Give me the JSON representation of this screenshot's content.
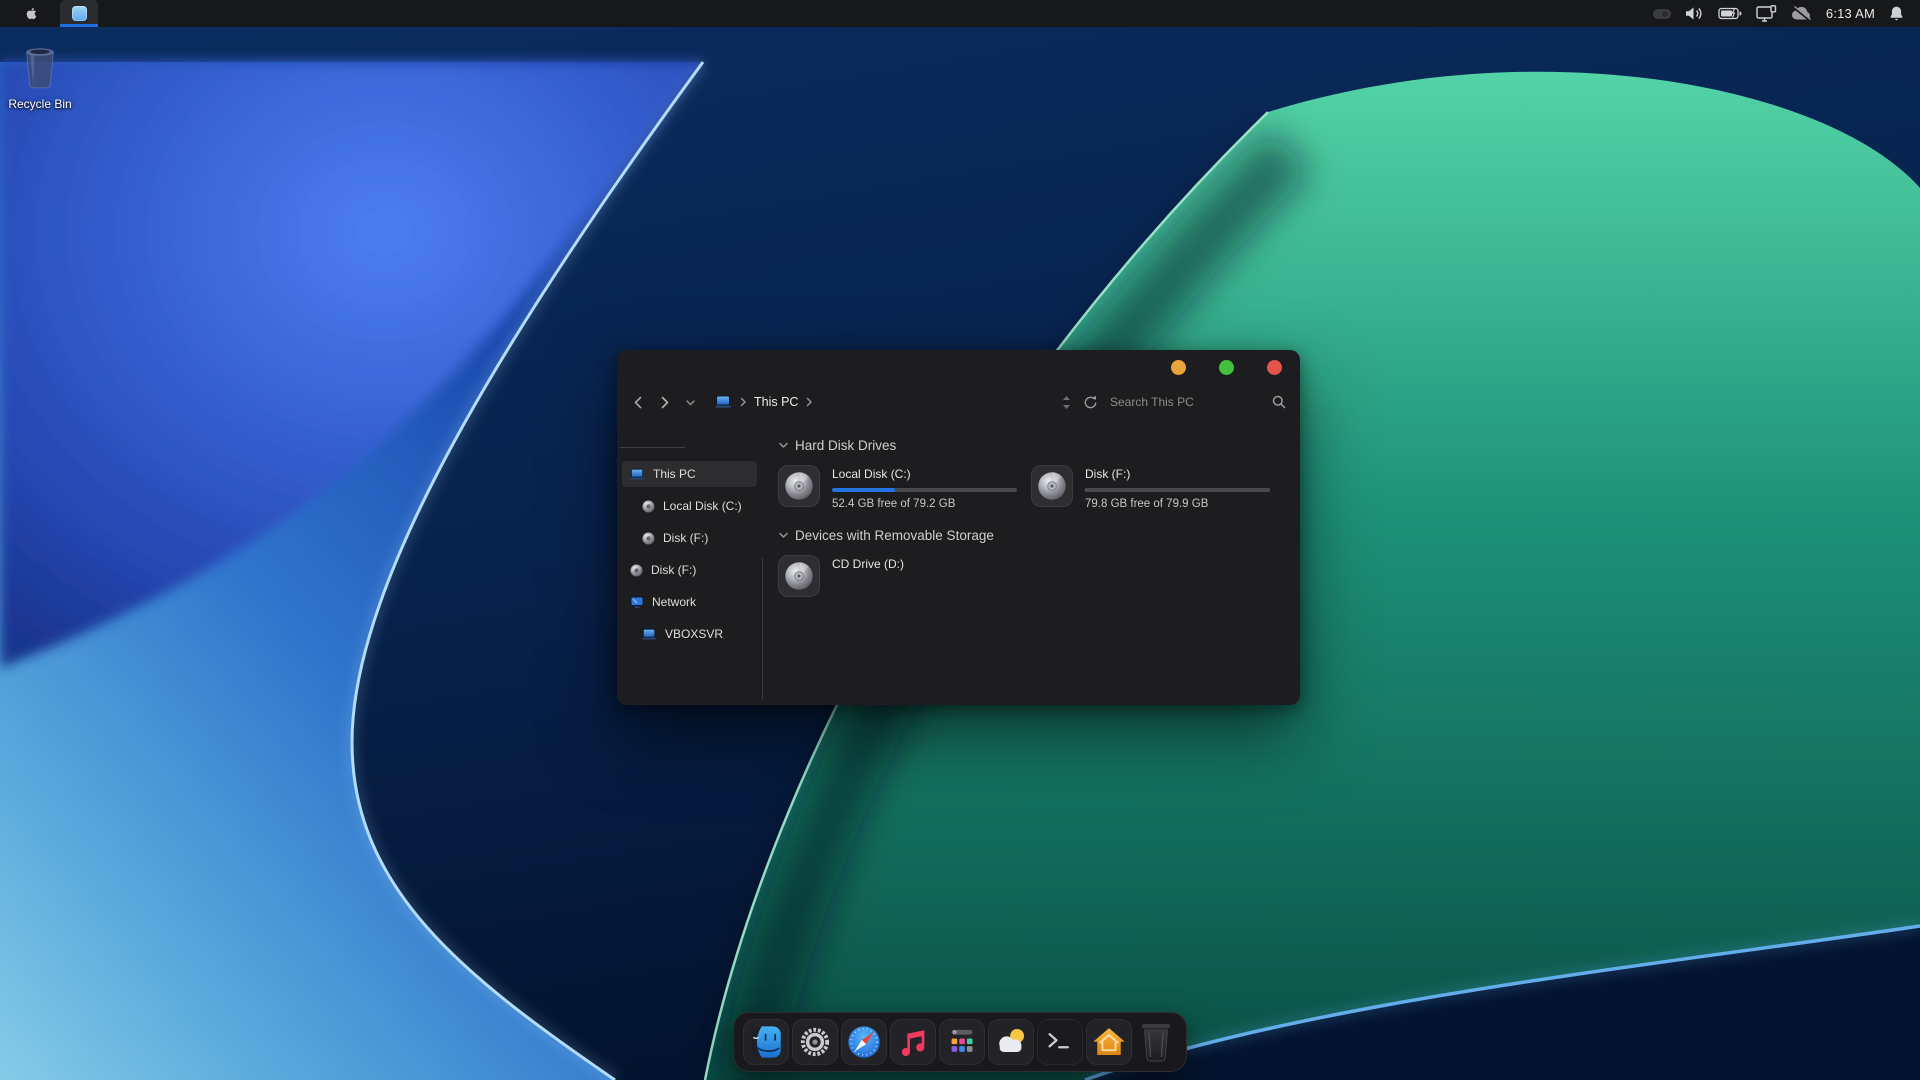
{
  "menubar": {
    "clock": "6:13 AM",
    "status_icons": [
      "hidden-items",
      "volume",
      "battery-charging",
      "display-network",
      "cloud-offline",
      "notification-bell"
    ]
  },
  "desktop": {
    "recycle_bin_label": "Recycle Bin"
  },
  "explorer": {
    "window_controls": [
      "minimize",
      "zoom",
      "close"
    ],
    "nav": {
      "location": "This PC",
      "search_placeholder": "Search This PC"
    },
    "sidebar": {
      "items": [
        {
          "label": "This PC",
          "icon": "pc-icon",
          "indent": 0,
          "selected": true
        },
        {
          "label": "Local Disk (C:)",
          "icon": "disk-icon",
          "indent": 1,
          "selected": false
        },
        {
          "label": "Disk (F:)",
          "icon": "disk-icon",
          "indent": 1,
          "selected": false
        },
        {
          "label": "Disk (F:)",
          "icon": "disk-icon",
          "indent": 0,
          "selected": false
        },
        {
          "label": "Network",
          "icon": "network-icon",
          "indent": 0,
          "selected": false
        },
        {
          "label": "VBOXSVR",
          "icon": "pc-icon",
          "indent": 1,
          "selected": false
        }
      ]
    },
    "sections": [
      {
        "title": "Hard Disk Drives",
        "items": [
          {
            "name": "Local Disk (C:)",
            "detail": "52.4 GB free of 79.2 GB",
            "used_percent": 33.8,
            "bar_style": "width:33.8%"
          },
          {
            "name": "Disk (F:)",
            "detail": "79.8 GB free of 79.9 GB",
            "used_percent": 0.6,
            "bar_style": "width:0.8%"
          }
        ]
      },
      {
        "title": "Devices with Removable Storage",
        "items": [
          {
            "name": "CD Drive (D:)"
          }
        ]
      }
    ]
  },
  "dock": {
    "items": [
      "finder",
      "system-settings",
      "safari",
      "music",
      "launchpad",
      "weather",
      "terminal",
      "home",
      "trash"
    ]
  },
  "colors": {
    "accent_blue": "#2374e1",
    "menubar_bg": "#17181a",
    "window_bg": "#1d1d1f",
    "traffic_minimize": "#e9a53b",
    "traffic_zoom": "#43c03c",
    "traffic_close": "#e4544a",
    "wallpaper_navy": "#0a2a58",
    "wallpaper_blue": "#2f74cc",
    "wallpaper_teal": "#1d9077"
  }
}
